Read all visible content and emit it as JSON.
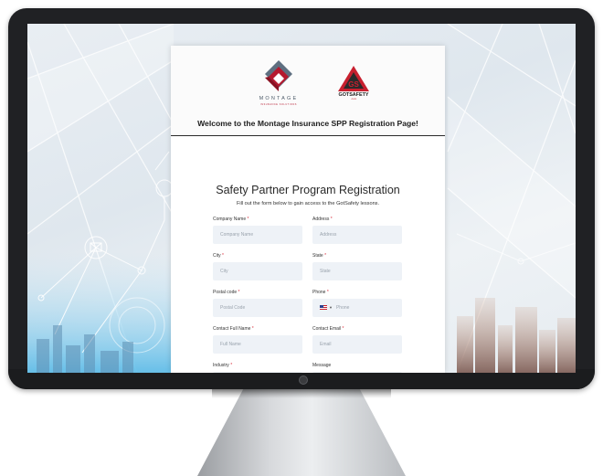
{
  "logos": {
    "montage_wordmark": "MONTAGE",
    "montage_tagline": "INSURANCE SOLUTIONS",
    "gotsafety_letters": "GS",
    "gotsafety_wordmark": "GOTSAFETY",
    "gotsafety_tagline": ".com"
  },
  "header": {
    "welcome": "Welcome to the Montage Insurance SPP Registration Page!"
  },
  "form": {
    "title": "Safety Partner Program Registration",
    "subtitle": "Fill out the form below to gain access to the GotSafety lessons.",
    "required_marker": "*",
    "fields": {
      "company_name": {
        "label": "Company Name",
        "placeholder": "Company Name",
        "required": true
      },
      "address": {
        "label": "Address",
        "placeholder": "Address",
        "required": true
      },
      "city": {
        "label": "City",
        "placeholder": "City",
        "required": true
      },
      "state": {
        "label": "State",
        "placeholder": "State",
        "required": true
      },
      "postal_code": {
        "label": "Postal code",
        "placeholder": "Postal Code",
        "required": true
      },
      "phone": {
        "label": "Phone",
        "placeholder": "Phone",
        "required": true,
        "country_flag": "us-flag-icon"
      },
      "contact_name": {
        "label": "Contact Full Name",
        "placeholder": "Full Name",
        "required": true
      },
      "contact_email": {
        "label": "Contact Email",
        "placeholder": "Email",
        "required": true
      },
      "industry": {
        "label": "Industry",
        "required": true
      },
      "message": {
        "label": "Message",
        "required": false
      }
    }
  },
  "colors": {
    "required": "#d9303e",
    "input_bg": "#eef2f7",
    "montage_red": "#b5182e",
    "gotsafety_red": "#c8202f"
  }
}
